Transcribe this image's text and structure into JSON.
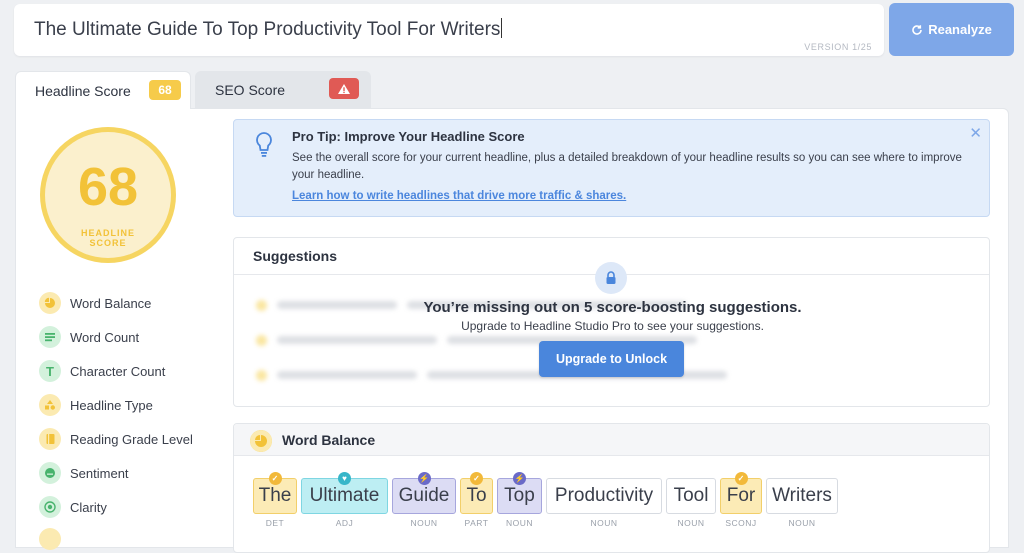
{
  "headline": {
    "text": "The Ultimate Guide To Top Productivity Tool For Writers",
    "version": "VERSION 1/25"
  },
  "reanalyze_label": "Reanalyze",
  "tabs": [
    {
      "label": "Headline Score",
      "badge": "68"
    },
    {
      "label": "SEO Score",
      "badge": "!"
    }
  ],
  "score": {
    "value": "68",
    "label_line1": "HEADLINE",
    "label_line2": "SCORE",
    "level": 0.68
  },
  "metrics": [
    {
      "label": "Word Balance",
      "icon": "pie-chart-icon",
      "color": "#f6cb4a"
    },
    {
      "label": "Word Count",
      "icon": "list-icon",
      "color": "#6fcb8f"
    },
    {
      "label": "Character Count",
      "icon": "text-t-icon",
      "color": "#6fcb8f"
    },
    {
      "label": "Headline Type",
      "icon": "shapes-icon",
      "color": "#f6cb4a"
    },
    {
      "label": "Reading Grade Level",
      "icon": "book-icon",
      "color": "#f6cb4a"
    },
    {
      "label": "Sentiment",
      "icon": "face-icon",
      "color": "#6fcb8f"
    },
    {
      "label": "Clarity",
      "icon": "target-icon",
      "color": "#6fcb8f"
    }
  ],
  "protip": {
    "title": "Pro Tip: Improve Your Headline Score",
    "body": "See the overall score for your current headline, plus a detailed breakdown of your headline results so you can see where to improve your headline.",
    "link": "Learn how to write headlines that drive more traffic & shares."
  },
  "suggestions": {
    "title": "Suggestions",
    "missing": "You’re missing out on 5 score-boosting suggestions.",
    "upgrade_text": "Upgrade to Headline Studio Pro to see your suggestions.",
    "button": "Upgrade to Unlock"
  },
  "word_balance": {
    "title": "Word Balance",
    "words": [
      {
        "text": "The",
        "tag": "DET",
        "type": "common"
      },
      {
        "text": "Ultimate",
        "tag": "ADJ",
        "type": "emotional"
      },
      {
        "text": "Guide",
        "tag": "NOUN",
        "type": "power"
      },
      {
        "text": "To",
        "tag": "PART",
        "type": "common"
      },
      {
        "text": "Top",
        "tag": "NOUN",
        "type": "power"
      },
      {
        "text": "Productivity",
        "tag": "NOUN",
        "type": "uncommon"
      },
      {
        "text": "Tool",
        "tag": "NOUN",
        "type": "uncommon"
      },
      {
        "text": "For",
        "tag": "SCONJ",
        "type": "common"
      },
      {
        "text": "Writers",
        "tag": "NOUN",
        "type": "uncommon"
      }
    ]
  },
  "colors": {
    "common": "#fcebb6",
    "emotional": "#bdeef3",
    "power": "#dcdcf4",
    "uncommon": "#ffffff",
    "accent": "#4a86dc",
    "score": "#f6cb4a"
  }
}
